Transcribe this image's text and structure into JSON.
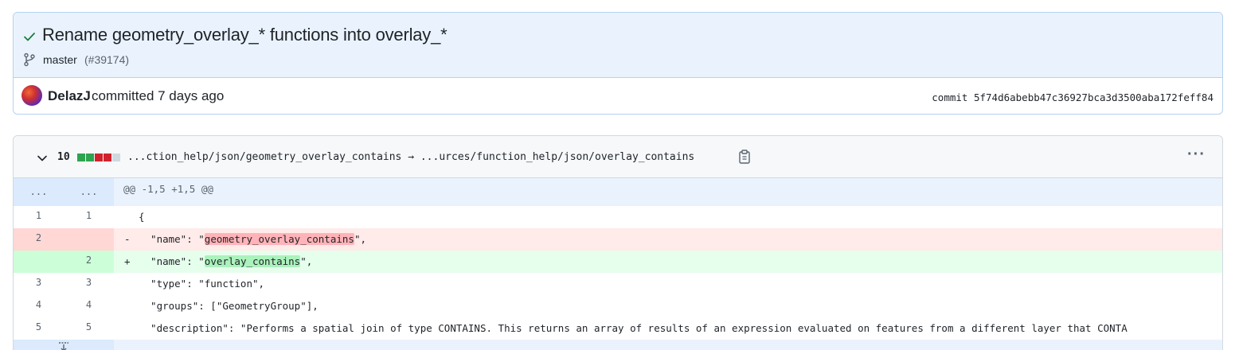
{
  "commit": {
    "title": "Rename geometry_overlay_* functions into overlay_*",
    "branch": "master",
    "pr": "(#39174)",
    "author": "DelazJ",
    "committed_text": "committed 7 days ago",
    "hash_text": "commit 5f74d6abebb47c36927bca3d3500aba172feff84"
  },
  "file": {
    "changes": "10",
    "diffstat": [
      "#2da44e",
      "#2da44e",
      "#cf222e",
      "#cf222e",
      "#d1d9e0"
    ],
    "path": "...ction_help/json/geometry_overlay_contains → ...urces/function_help/json/overlay_contains"
  },
  "diff": {
    "hunk_old": "...",
    "hunk_new": "...",
    "hunk_header": "@@ -1,5 +1,5 @@",
    "lines": [
      {
        "type": "context",
        "old": "1",
        "new": "1",
        "marker": "",
        "pre": "{",
        "hl": "",
        "post": ""
      },
      {
        "type": "del",
        "old": "2",
        "new": "",
        "marker": "-",
        "pre": "  \"name\": \"",
        "hl": "geometry_overlay_contains",
        "post": "\","
      },
      {
        "type": "add",
        "old": "",
        "new": "2",
        "marker": "+",
        "pre": "  \"name\": \"",
        "hl": "overlay_contains",
        "post": "\","
      },
      {
        "type": "context",
        "old": "3",
        "new": "3",
        "marker": "",
        "pre": "  \"type\": \"function\",",
        "hl": "",
        "post": ""
      },
      {
        "type": "context",
        "old": "4",
        "new": "4",
        "marker": "",
        "pre": "  \"groups\": [\"GeometryGroup\"],",
        "hl": "",
        "post": ""
      },
      {
        "type": "context",
        "old": "5",
        "new": "5",
        "marker": "",
        "pre": "  \"description\": \"Performs a spatial join of type CONTAINS. This returns an array of results of an expression evaluated on features from a different layer that CONTA",
        "hl": "",
        "post": ""
      }
    ]
  }
}
